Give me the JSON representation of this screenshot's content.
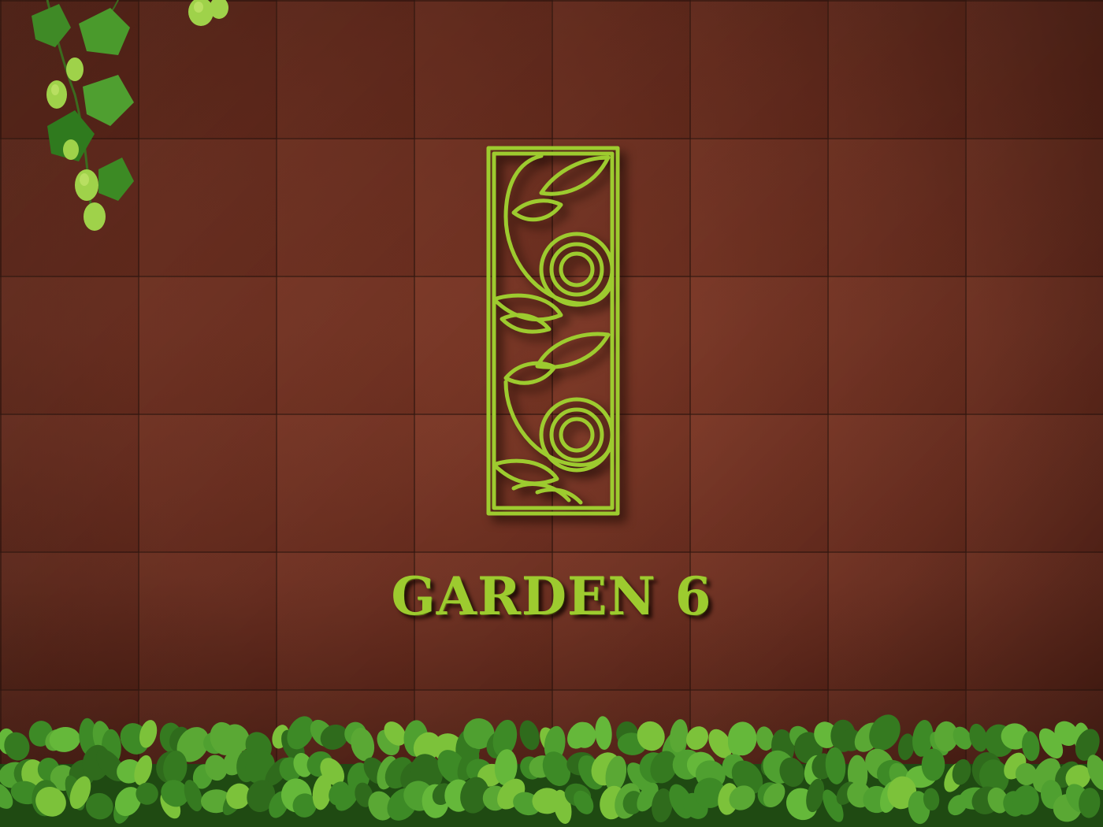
{
  "sign": {
    "brand_name": "GARDEN 6"
  },
  "colors": {
    "wall": "#6a2c1e",
    "tile_line": "#2a0f07",
    "logo_green": "#9dcb2f",
    "leaf_dark": "#2f6b1c",
    "leaf_light": "#7cc23a"
  },
  "icons": {
    "logo": "floral-panel-icon",
    "vine": "hanging-vine-icon",
    "hedge": "leafy-hedge-icon"
  }
}
